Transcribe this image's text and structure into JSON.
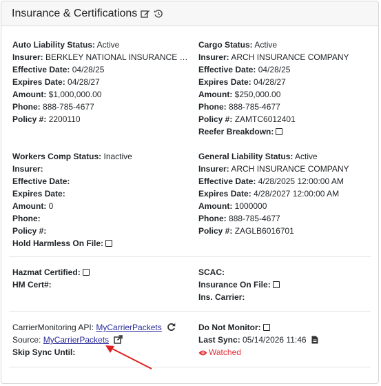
{
  "header": {
    "title": "Insurance & Certifications"
  },
  "auto": {
    "status_label": "Auto Liability Status:",
    "status": "Active",
    "insurer_label": "Insurer:",
    "insurer": "BERKLEY NATIONAL INSURANCE CO...",
    "eff_label": "Effective Date:",
    "eff": "04/28/25",
    "exp_label": "Expires Date:",
    "exp": "04/28/27",
    "amt_label": "Amount:",
    "amt": "$1,000,000.00",
    "phone_label": "Phone:",
    "phone": "888-785-4677",
    "policy_label": "Policy #:",
    "policy": "2200110"
  },
  "cargo": {
    "status_label": "Cargo Status:",
    "status": "Active",
    "insurer_label": "Insurer:",
    "insurer": "ARCH INSURANCE COMPANY",
    "eff_label": "Effective Date:",
    "eff": "04/28/25",
    "exp_label": "Expires Date:",
    "exp": "04/28/27",
    "amt_label": "Amount:",
    "amt": "$250,000.00",
    "phone_label": "Phone:",
    "phone": "888-785-4677",
    "policy_label": "Policy #:",
    "policy": "ZAMTC6012401",
    "reefer_label": "Reefer Breakdown:"
  },
  "workers": {
    "status_label": "Workers Comp Status:",
    "status": "Inactive",
    "insurer_label": "Insurer:",
    "insurer": "",
    "eff_label": "Effective Date:",
    "eff": "",
    "exp_label": "Expires Date:",
    "exp": "",
    "amt_label": "Amount:",
    "amt": "0",
    "phone_label": "Phone:",
    "phone": "",
    "policy_label": "Policy #:",
    "policy": "",
    "hold_label": "Hold Harmless On File:"
  },
  "general": {
    "status_label": "General Liability Status:",
    "status": "Active",
    "insurer_label": "Insurer:",
    "insurer": "ARCH INSURANCE COMPANY",
    "eff_label": "Effective Date:",
    "eff": "4/28/2025 12:00:00 AM",
    "exp_label": "Expires Date:",
    "exp": "4/28/2027 12:00:00 AM",
    "amt_label": "Amount:",
    "amt": "1000000",
    "phone_label": "Phone:",
    "phone": "888-785-4677",
    "policy_label": "Policy #:",
    "policy": "ZAGLB6016701"
  },
  "hazmat": {
    "certified_label": "Hazmat Certified:",
    "hm_cert_label": "HM Cert#:",
    "hm_cert": ""
  },
  "scac": {
    "scac_label": "SCAC:",
    "scac": "",
    "ins_on_file_label": "Insurance On File:",
    "ins_carrier_label": "Ins. Carrier:",
    "ins_carrier": ""
  },
  "monitoring": {
    "api_label": "CarrierMonitoring API:",
    "api_link": "MyCarrierPackets",
    "source_label": "Source:",
    "source_link": "MyCarrierPackets",
    "skip_label": "Skip Sync Until:",
    "skip": "",
    "do_not_monitor_label": "Do Not Monitor:",
    "last_sync_label": "Last Sync:",
    "last_sync": "05/14/2026 11:46",
    "watched": "Watched"
  },
  "icons": {
    "edit": "edit-icon",
    "history": "history-icon",
    "refresh": "refresh-icon",
    "external_link": "external-link-icon",
    "file": "file-icon",
    "eye": "eye-icon",
    "arrow": "red-arrow-annotation"
  },
  "colors": {
    "link": "#2a2a9a",
    "watched": "#e0303a",
    "arrow": "#e02020"
  }
}
